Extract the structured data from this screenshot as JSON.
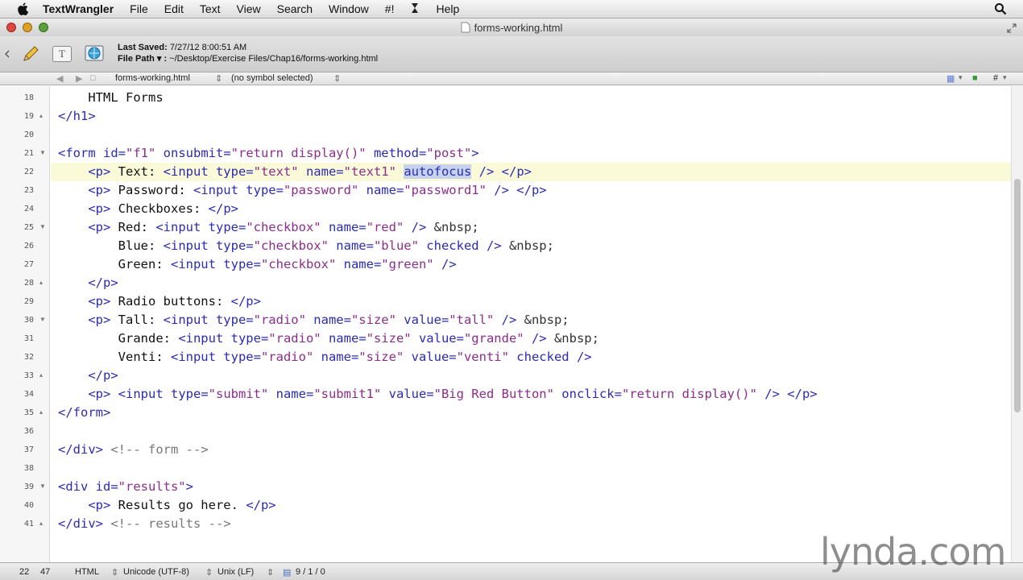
{
  "menubar": {
    "app_name": "TextWrangler",
    "menus": [
      "File",
      "Edit",
      "Text",
      "View",
      "Search",
      "Window",
      "#!",
      "Help"
    ]
  },
  "window": {
    "title": "forms-working.html"
  },
  "toolbar": {
    "last_saved_label": "Last Saved:",
    "last_saved_value": "7/27/12 8:00:51 AM",
    "file_path_label": "File Path ▾ :",
    "file_path_value": "~/Desktop/Exercise Files/Chap16/forms-working.html"
  },
  "navbar": {
    "file_menu": "forms-working.html",
    "symbol_menu": "(no symbol selected)",
    "hash": "#"
  },
  "editor": {
    "current_line": "22",
    "selected_text": "autofocus",
    "lines": [
      {
        "n": "18",
        "fold": "",
        "html": "    HTML Forms"
      },
      {
        "n": "19",
        "fold": "▴",
        "html": "<span class=\"tag\">&lt;/h1&gt;</span>"
      },
      {
        "n": "20",
        "fold": "",
        "html": ""
      },
      {
        "n": "21",
        "fold": "▼",
        "html": "<span class=\"tag\">&lt;form id=</span><span class=\"val\">\"f1\"</span><span class=\"tag\"> onsubmit=</span><span class=\"val\">\"return display()\"</span><span class=\"tag\"> method=</span><span class=\"val\">\"post\"</span><span class=\"tag\">&gt;</span>"
      },
      {
        "n": "22",
        "fold": "",
        "html": "    <span class=\"tag\">&lt;p&gt;</span> Text: <span class=\"tag\">&lt;input type=</span><span class=\"val\">\"text\"</span><span class=\"tag\"> name=</span><span class=\"val\">\"text1\"</span> <span class=\"tag\" style=\"background:#c7d3ec\">autofocus</span><span class=\"tag\"> /&gt;</span> <span class=\"tag\">&lt;/p&gt;</span>"
      },
      {
        "n": "23",
        "fold": "",
        "html": "    <span class=\"tag\">&lt;p&gt;</span> Password: <span class=\"tag\">&lt;input type=</span><span class=\"val\">\"password\"</span><span class=\"tag\"> name=</span><span class=\"val\">\"password1\"</span><span class=\"tag\"> /&gt;</span> <span class=\"tag\">&lt;/p&gt;</span>"
      },
      {
        "n": "24",
        "fold": "",
        "html": "    <span class=\"tag\">&lt;p&gt;</span> Checkboxes: <span class=\"tag\">&lt;/p&gt;</span>"
      },
      {
        "n": "25",
        "fold": "▼",
        "html": "    <span class=\"tag\">&lt;p&gt;</span> Red: <span class=\"tag\">&lt;input type=</span><span class=\"val\">\"checkbox\"</span><span class=\"tag\"> name=</span><span class=\"val\">\"red\"</span><span class=\"tag\"> /&gt;</span> <span class=\"ent\">&amp;nbsp;</span>"
      },
      {
        "n": "26",
        "fold": "",
        "html": "        Blue: <span class=\"tag\">&lt;input type=</span><span class=\"val\">\"checkbox\"</span><span class=\"tag\"> name=</span><span class=\"val\">\"blue\"</span><span class=\"tag\"> checked /&gt;</span> <span class=\"ent\">&amp;nbsp;</span>"
      },
      {
        "n": "27",
        "fold": "",
        "html": "        Green: <span class=\"tag\">&lt;input type=</span><span class=\"val\">\"checkbox\"</span><span class=\"tag\"> name=</span><span class=\"val\">\"green\"</span><span class=\"tag\"> /&gt;</span>"
      },
      {
        "n": "28",
        "fold": "▴",
        "html": "    <span class=\"tag\">&lt;/p&gt;</span>"
      },
      {
        "n": "29",
        "fold": "",
        "html": "    <span class=\"tag\">&lt;p&gt;</span> Radio buttons: <span class=\"tag\">&lt;/p&gt;</span>"
      },
      {
        "n": "30",
        "fold": "▼",
        "html": "    <span class=\"tag\">&lt;p&gt;</span> Tall: <span class=\"tag\">&lt;input type=</span><span class=\"val\">\"radio\"</span><span class=\"tag\"> name=</span><span class=\"val\">\"size\"</span><span class=\"tag\"> value=</span><span class=\"val\">\"tall\"</span><span class=\"tag\"> /&gt;</span> <span class=\"ent\">&amp;nbsp;</span>"
      },
      {
        "n": "31",
        "fold": "",
        "html": "        Grande: <span class=\"tag\">&lt;input type=</span><span class=\"val\">\"radio\"</span><span class=\"tag\"> name=</span><span class=\"val\">\"size\"</span><span class=\"tag\"> value=</span><span class=\"val\">\"grande\"</span><span class=\"tag\"> /&gt;</span> <span class=\"ent\">&amp;nbsp;</span>"
      },
      {
        "n": "32",
        "fold": "",
        "html": "        Venti: <span class=\"tag\">&lt;input type=</span><span class=\"val\">\"radio\"</span><span class=\"tag\"> name=</span><span class=\"val\">\"size\"</span><span class=\"tag\"> value=</span><span class=\"val\">\"venti\"</span><span class=\"tag\"> checked /&gt;</span>"
      },
      {
        "n": "33",
        "fold": "▴",
        "html": "    <span class=\"tag\">&lt;/p&gt;</span>"
      },
      {
        "n": "34",
        "fold": "",
        "html": "    <span class=\"tag\">&lt;p&gt;</span> <span class=\"tag\">&lt;input type=</span><span class=\"val\">\"submit\"</span><span class=\"tag\"> name=</span><span class=\"val\">\"submit1\"</span><span class=\"tag\"> value=</span><span class=\"val\">\"Big Red Button\"</span><span class=\"tag\"> onclick=</span><span class=\"val\">\"return display()\"</span><span class=\"tag\"> /&gt;</span> <span class=\"tag\">&lt;/p&gt;</span>"
      },
      {
        "n": "35",
        "fold": "▴",
        "html": "<span class=\"tag\">&lt;/form&gt;</span>"
      },
      {
        "n": "36",
        "fold": "",
        "html": ""
      },
      {
        "n": "37",
        "fold": "",
        "html": "<span class=\"tag\">&lt;/div&gt;</span> <span class=\"cmt\">&lt;!-- form --&gt;</span>"
      },
      {
        "n": "38",
        "fold": "",
        "html": ""
      },
      {
        "n": "39",
        "fold": "▼",
        "html": "<span class=\"tag\">&lt;div id=</span><span class=\"val\">\"results\"</span><span class=\"tag\">&gt;</span>"
      },
      {
        "n": "40",
        "fold": "",
        "html": "    <span class=\"tag\">&lt;p&gt;</span> Results go here. <span class=\"tag\">&lt;/p&gt;</span>"
      },
      {
        "n": "41",
        "fold": "▴",
        "html": "<span class=\"tag\">&lt;/div&gt;</span> <span class=\"cmt\">&lt;!-- results --&gt;</span>"
      }
    ]
  },
  "statusbar": {
    "line": "22",
    "column": "47",
    "language": "HTML",
    "encoding": "Unicode (UTF-8)",
    "line_endings": "Unix (LF)",
    "counts": "9 / 1 / 0"
  },
  "watermark": "lynda.com"
}
